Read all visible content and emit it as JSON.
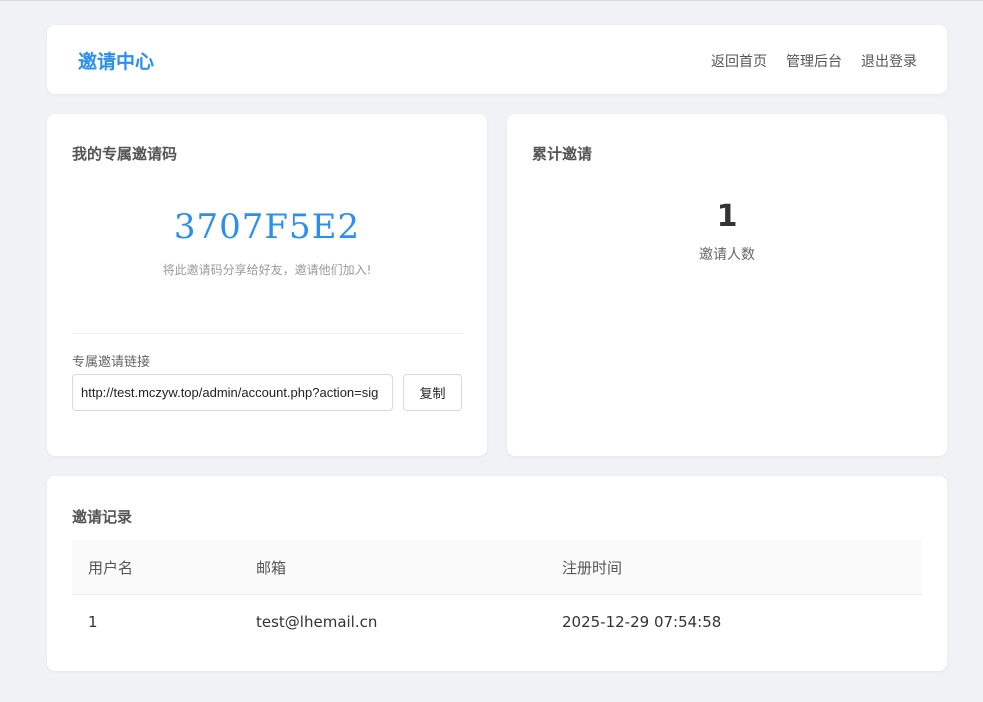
{
  "header": {
    "brand": "邀请中心",
    "nav": [
      "返回首页",
      "管理后台",
      "退出登录"
    ]
  },
  "invite_code_card": {
    "title": "我的专属邀请码",
    "code": "3707F5E2",
    "hint": "将此邀请码分享给好友，邀请他们加入!",
    "link_label": "专属邀请链接",
    "link_value": "http://test.mczyw.top/admin/account.php?action=sig",
    "copy_label": "复制"
  },
  "stats_card": {
    "title": "累计邀请",
    "count": "1",
    "count_label": "邀请人数"
  },
  "records": {
    "title": "邀请记录",
    "columns": [
      "用户名",
      "邮箱",
      "注册时间"
    ],
    "rows": [
      [
        "1",
        "test@lhemail.cn",
        "2025-12-29 07:54:58"
      ]
    ]
  },
  "colors": {
    "accent": "#2b8ff0",
    "background": "#f0f2f5"
  }
}
